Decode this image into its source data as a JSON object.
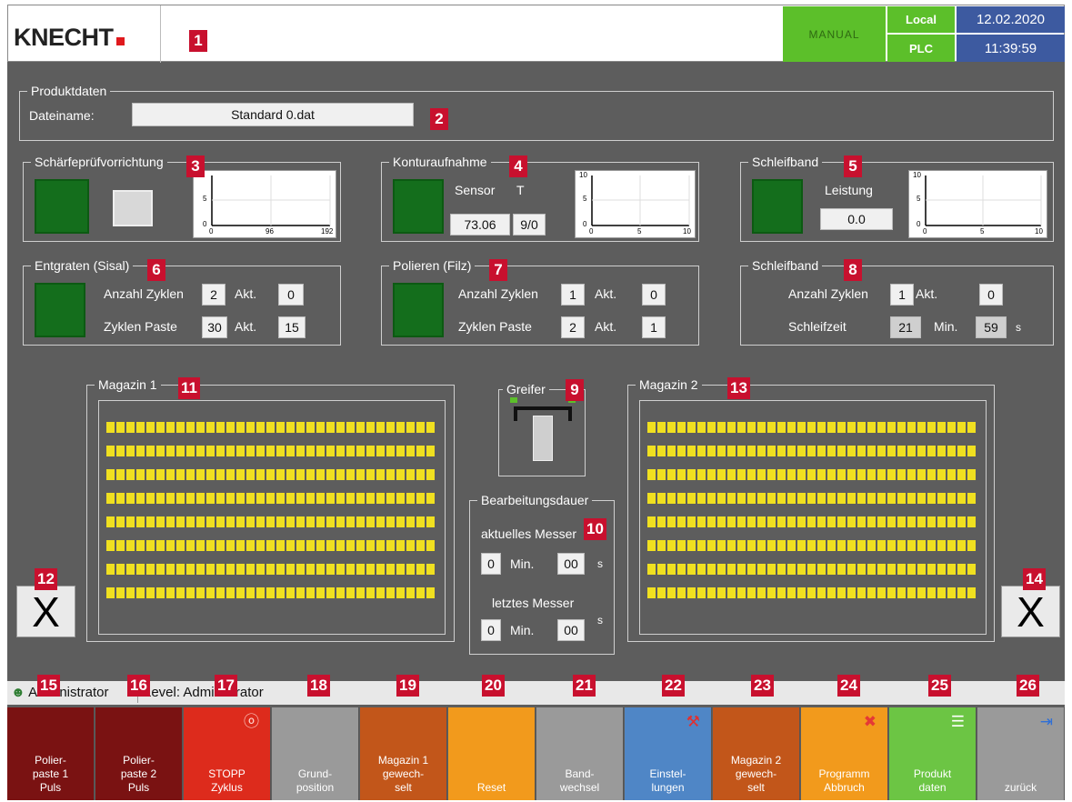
{
  "header": {
    "logo": "KNECHT",
    "mode": "MANUAL",
    "local": "Local",
    "plc": "PLC",
    "date": "12.02.2020",
    "time": "11:39:59"
  },
  "markers": [
    "1",
    "2",
    "3",
    "4",
    "5",
    "6",
    "7",
    "8",
    "9",
    "10",
    "11",
    "12",
    "13",
    "14",
    "15",
    "16",
    "17",
    "18",
    "19",
    "20",
    "21",
    "22",
    "23",
    "24",
    "25",
    "26"
  ],
  "produktdaten": {
    "title": "Produktdaten",
    "dateiname_label": "Dateiname:",
    "dateiname_value": "Standard 0.dat"
  },
  "schaerfe": {
    "title": "Schärfeprüfvorrichtung",
    "chart": {
      "y_ticks": [
        "5",
        "0"
      ],
      "x_ticks": [
        "0",
        "96",
        "192"
      ]
    }
  },
  "kontur": {
    "title": "Konturaufnahme",
    "sensor_label": "Sensor",
    "t_label": "T",
    "sensor_value": "73.06",
    "t_value": "9/0",
    "chart": {
      "y_ticks": [
        "10",
        "5",
        "0"
      ],
      "x_ticks": [
        "0",
        "5",
        "10"
      ]
    }
  },
  "schleifband1": {
    "title": "Schleifband",
    "leistung_label": "Leistung",
    "leistung_value": "0.0",
    "chart": {
      "y_ticks": [
        "10",
        "5",
        "0"
      ],
      "x_ticks": [
        "0",
        "5",
        "10"
      ]
    }
  },
  "entgraten": {
    "title": "Entgraten (Sisal)",
    "anzahl_label": "Anzahl Zyklen",
    "anzahl_value": "2",
    "akt_label": "Akt.",
    "anzahl_akt": "0",
    "paste_label": "Zyklen Paste",
    "paste_value": "30",
    "paste_akt": "15"
  },
  "polieren": {
    "title": "Polieren (Filz)",
    "anzahl_label": "Anzahl Zyklen",
    "anzahl_value": "1",
    "akt_label": "Akt.",
    "anzahl_akt": "0",
    "paste_label": "Zyklen Paste",
    "paste_value": "2",
    "paste_akt": "1"
  },
  "schleifband2": {
    "title": "Schleifband",
    "anzahl_label": "Anzahl Zyklen",
    "anzahl_value": "1",
    "akt_label": "Akt.",
    "anzahl_akt": "0",
    "zeit_label": "Schleifzeit",
    "zeit_min": "21",
    "min_label": "Min.",
    "zeit_s": "59",
    "s_label": "s"
  },
  "magazin1": {
    "title": "Magazin 1"
  },
  "magazin2": {
    "title": "Magazin 2"
  },
  "greifer": {
    "title": "Greifer"
  },
  "bearbeitung": {
    "title": "Bearbeitungsdauer",
    "aktuell_label": "aktuelles Messer",
    "aktuell_min": "0",
    "aktuell_s": "00",
    "letztes_label": "letztes Messer",
    "letztes_min": "0",
    "letztes_s": "00",
    "min_label": "Min.",
    "s_label": "s"
  },
  "x_button": "X",
  "statusbar": {
    "user": "Administrator",
    "level": "Level: Administrator"
  },
  "buttons": [
    {
      "label": "Polier-\npaste 1\nPuls",
      "color": "#7a1212",
      "icon": ""
    },
    {
      "label": "Polier-\npaste 2\nPuls",
      "color": "#7a1212",
      "icon": ""
    },
    {
      "label": "STOPP\nZyklus",
      "color": "#dd2b1c",
      "icon": "stop-icon"
    },
    {
      "label": "Grund-\nposition",
      "color": "#9a9a9a",
      "icon": ""
    },
    {
      "label": "Magazin 1\ngewech-\nselt",
      "color": "#c2561a",
      "icon": ""
    },
    {
      "label": "Reset",
      "color": "#f29a1c",
      "icon": ""
    },
    {
      "label": "Band-\nwechsel",
      "color": "#9a9a9a",
      "icon": ""
    },
    {
      "label": "Einstel-\nlungen",
      "color": "#4f86c6",
      "icon": "wrench-icon"
    },
    {
      "label": "Magazin 2\ngewech-\nselt",
      "color": "#c2561a",
      "icon": ""
    },
    {
      "label": "Programm\nAbbruch",
      "color": "#f29a1c",
      "icon": "cancel-icon"
    },
    {
      "label": "Produkt\ndaten",
      "color": "#6cc544",
      "icon": "document-icon"
    },
    {
      "label": "zurück",
      "color": "#9a9a9a",
      "icon": "exit-icon"
    }
  ]
}
